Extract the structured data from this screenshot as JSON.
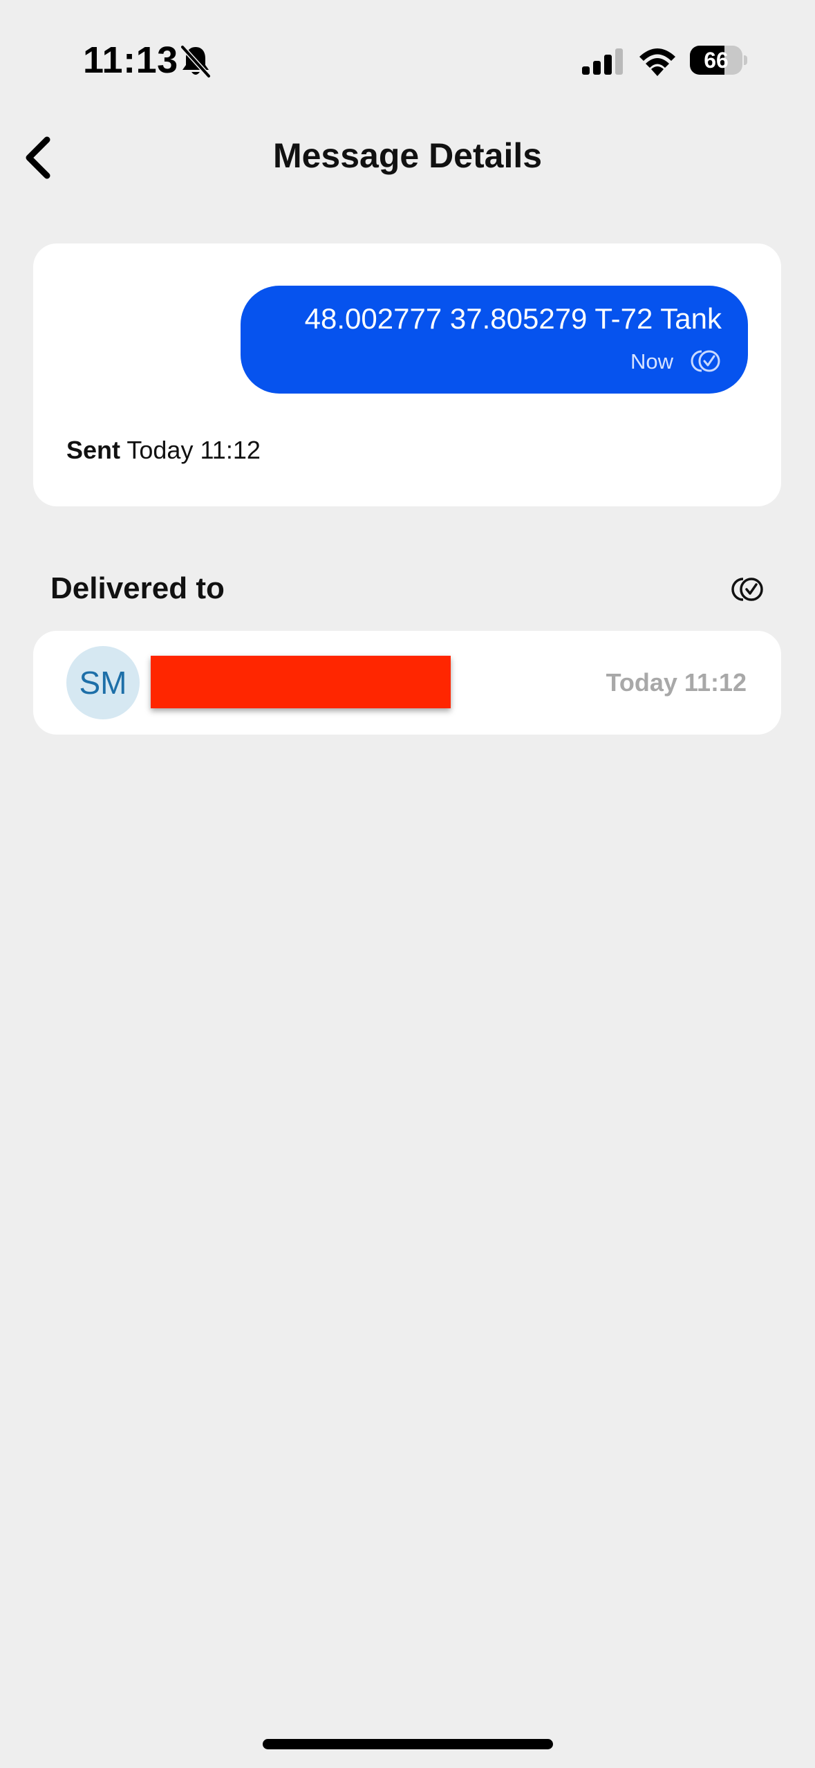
{
  "status_bar": {
    "time": "11:13",
    "battery_level": "66",
    "battery_fraction": 0.66,
    "icons": [
      "bell-slash-icon",
      "cellular-signal-icon",
      "wifi-icon",
      "battery-icon"
    ]
  },
  "header": {
    "title": "Message Details",
    "back_icon": "chevron-left-icon"
  },
  "message": {
    "text": "48.002777 37.805279 T-72 Tank",
    "time": "Now",
    "bubble_color": "#0653ee",
    "status_icon": "double-check-icon"
  },
  "sent": {
    "label": "Sent",
    "value": "Today 11:12"
  },
  "delivered": {
    "header": "Delivered to",
    "icon": "double-check-icon",
    "recipients": [
      {
        "initials": "SM",
        "name_redacted": true,
        "redaction_color": "#ff2600",
        "time": "Today 11:12"
      }
    ]
  }
}
